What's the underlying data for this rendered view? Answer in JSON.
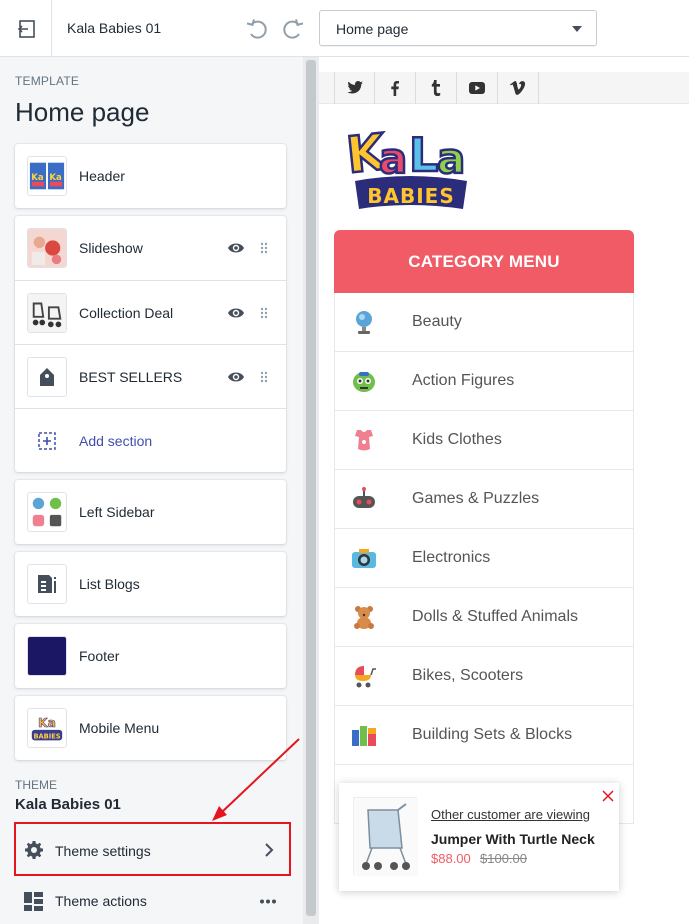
{
  "topbar": {
    "store_name": "Kala Babies 01",
    "page_select_value": "Home page"
  },
  "sidebar": {
    "template_label": "TEMPLATE",
    "template_title": "Home page",
    "sections": [
      {
        "label": "Header"
      },
      {
        "label": "Slideshow"
      },
      {
        "label": "Collection Deal"
      },
      {
        "label": "BEST SELLERS"
      },
      {
        "label": "Add section"
      },
      {
        "label": "Left Sidebar"
      },
      {
        "label": "List Blogs"
      },
      {
        "label": "Footer"
      },
      {
        "label": "Mobile Menu"
      }
    ],
    "theme_label": "THEME",
    "theme_name": "Kala Babies 01",
    "theme_settings": "Theme settings",
    "theme_actions": "Theme actions"
  },
  "preview": {
    "social_icons": [
      "twitter-icon",
      "facebook-icon",
      "tumblr-icon",
      "youtube-icon",
      "vimeo-icon"
    ],
    "logo_text": "Kala BABIES",
    "category_header": "CATEGORY MENU",
    "categories": [
      {
        "label": "Beauty",
        "icon": "globe-icon"
      },
      {
        "label": "Action Figures",
        "icon": "robot-icon"
      },
      {
        "label": "Kids Clothes",
        "icon": "bib-icon"
      },
      {
        "label": "Games & Puzzles",
        "icon": "gamepad-icon"
      },
      {
        "label": "Electronics",
        "icon": "camera-icon"
      },
      {
        "label": "Dolls & Stuffed Animals",
        "icon": "teddy-bear-icon"
      },
      {
        "label": "Bikes, Scooters",
        "icon": "stroller-icon"
      },
      {
        "label": "Building Sets & Blocks",
        "icon": "blocks-icon"
      }
    ],
    "popup": {
      "viewing": "Other customer are viewing",
      "title": "Jumper With Turtle Neck",
      "price": "$88.00",
      "old_price": "$100.00"
    }
  },
  "colors": {
    "accent_red": "#f15b65",
    "highlight_red": "#e4151f",
    "link_blue": "#3f4eae"
  }
}
